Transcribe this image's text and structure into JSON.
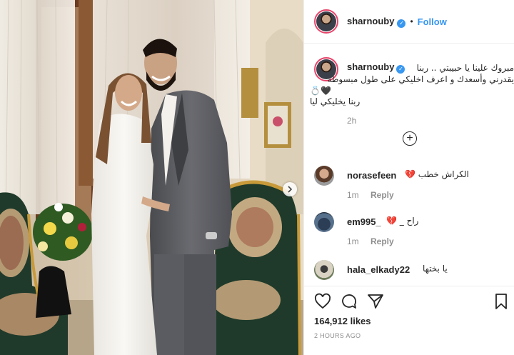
{
  "post": {
    "username": "sharnouby",
    "follow_label": "Follow",
    "separator": "•",
    "verified_mark": "✓"
  },
  "caption": {
    "username": "sharnouby",
    "line1": "مبروك علينا يا حبيبتي .. ربنا",
    "line2": "يقدرني وأسعدك و اعرف اخليكي على طول مبسوطة",
    "line3": "💍🖤",
    "line4": "ربنا يخليكي ليا",
    "time": "2h"
  },
  "load_more_label": "+",
  "comments": [
    {
      "username": "norasefeen",
      "text": "الكراش خطب 💔",
      "time": "1m",
      "reply": "Reply"
    },
    {
      "username": "em995_",
      "text": "راح _ 💔",
      "time": "1m",
      "reply": "Reply"
    },
    {
      "username": "hala_elkady22",
      "text": "يا بختها",
      "time": "",
      "reply": ""
    }
  ],
  "actions": {
    "likes": "164,912 likes",
    "posted_ago": "2 HOURS AGO",
    "icons": [
      "heart-icon",
      "comment-icon",
      "share-icon",
      "bookmark-icon"
    ]
  },
  "colors": {
    "accent": "#3897f0",
    "story_ring": "#e8456b",
    "muted": "#8e8e8e",
    "text": "#262626"
  }
}
